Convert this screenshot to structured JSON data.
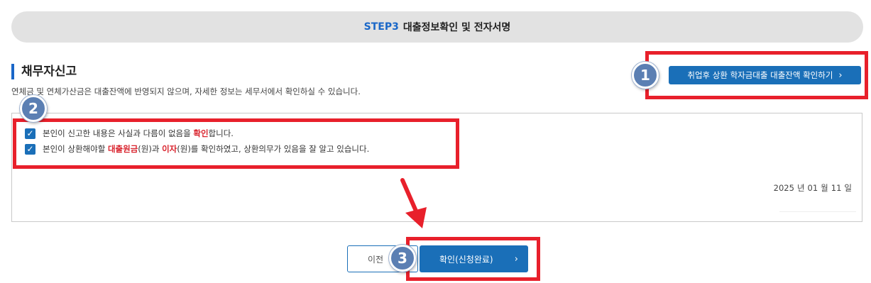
{
  "step": {
    "number": "STEP3",
    "title": "대출정보확인 및 전자서명"
  },
  "section": {
    "title": "채무자신고",
    "description": "연체금 및 연체가산금은 대출잔액에 반영되지 않으며, 자세한 정보는 세무서에서 확인하실 수 있습니다."
  },
  "balance_button": {
    "label": "취업후 상환 학자금대출 대출잔액 확인하기",
    "icon": "chevron-right-icon"
  },
  "consents": [
    {
      "checked": true,
      "pre": "본인이 신고한 내용은 사실과 다름이 없음을 ",
      "highlight": "확인",
      "post": "합니다."
    },
    {
      "checked": true,
      "pre": "본인이 상환해야할 ",
      "highlight1": "대출원금",
      "mid": "(원)과 ",
      "highlight2": "이자",
      "post": "(원)를 확인하였고, 상환의무가 있음을 잘 알고 있습니다."
    }
  ],
  "date": {
    "year": "2025",
    "year_unit": "년",
    "month": "01",
    "month_unit": "월",
    "day": "11",
    "day_unit": "일"
  },
  "buttons": {
    "prev_label": "이전",
    "confirm_label": "확인(신청완료)"
  },
  "callouts": [
    "1",
    "2",
    "3"
  ],
  "colors": {
    "accent": "#1a6fb8",
    "highlight": "#d9232d",
    "annotation_frame": "#e8202b",
    "callout": "#5b7fb3"
  }
}
